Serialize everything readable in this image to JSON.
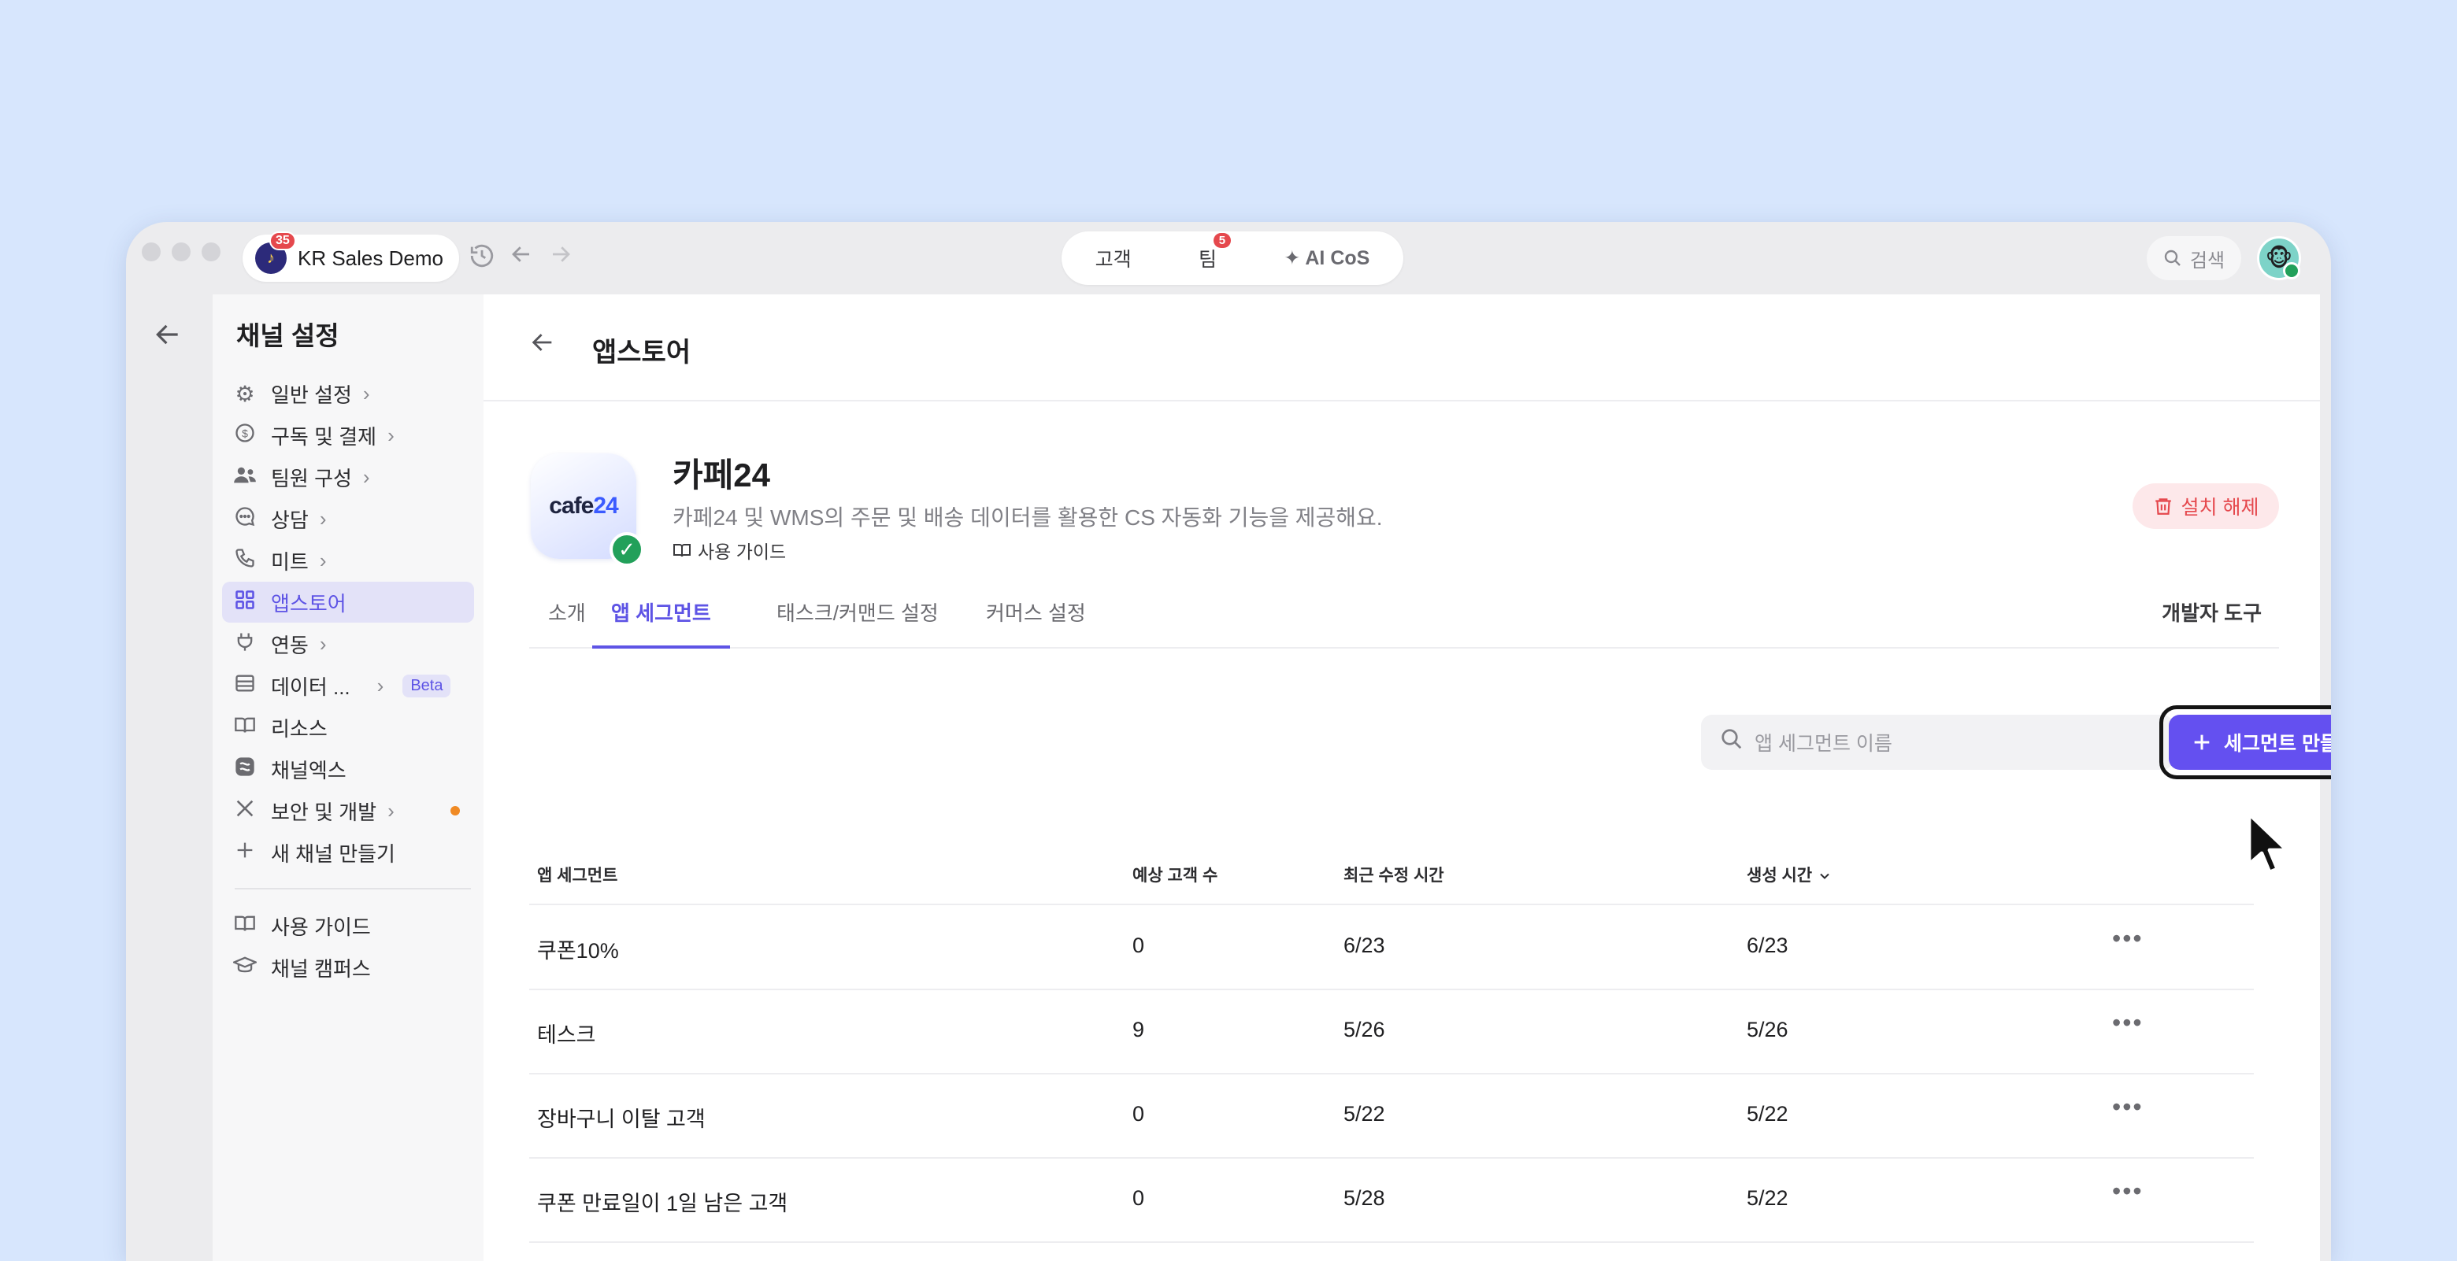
{
  "titlebar": {
    "workspace_name": "KR Sales Demo",
    "workspace_badge": "35",
    "center_tabs": [
      {
        "label": "고객"
      },
      {
        "label": "팀",
        "badge": "5"
      },
      {
        "label": "AI CoS"
      }
    ],
    "search_label": "검색"
  },
  "sidebar": {
    "title": "채널 설정",
    "items": [
      {
        "label": "일반 설정",
        "icon": "gear-icon"
      },
      {
        "label": "구독 및 결제",
        "icon": "dollar-icon"
      },
      {
        "label": "팀원 구성",
        "icon": "people-icon"
      },
      {
        "label": "상담",
        "icon": "chat-icon"
      },
      {
        "label": "미트",
        "icon": "phone-icon"
      },
      {
        "label": "앱스토어",
        "icon": "grid-icon"
      },
      {
        "label": "연동",
        "icon": "plug-icon"
      },
      {
        "label": "데이터 ...",
        "icon": "database-icon",
        "badge": "Beta"
      },
      {
        "label": "리소스",
        "icon": "book-icon"
      },
      {
        "label": "채널엑스",
        "icon": "channelx-icon"
      },
      {
        "label": "보안 및 개발",
        "icon": "tools-icon"
      },
      {
        "label": "새 채널 만들기",
        "icon": "plus-icon"
      },
      {
        "label": "사용 가이드",
        "icon": "book-icon"
      },
      {
        "label": "채널 캠퍼스",
        "icon": "graduation-icon"
      }
    ]
  },
  "main": {
    "page_title": "앱스토어",
    "app": {
      "logo_text_a": "cafe",
      "logo_text_b": "24",
      "name": "카페24",
      "description": "카페24 및 WMS의 주문 및 배송 데이터를 활용한 CS 자동화 기능을 제공해요.",
      "guide_label": "사용 가이드",
      "uninstall_label": "설치 해제"
    },
    "tabs": [
      "소개",
      "앱 세그먼트",
      "태스크/커맨드 설정",
      "커머스 설정"
    ],
    "active_tab": "앱 세그먼트",
    "dev_tools_label": "개발자 도구",
    "search_placeholder": "앱 세그먼트 이름",
    "create_button_label": "세그먼트 만들기",
    "table": {
      "columns": [
        "앱 세그먼트",
        "예상 고객 수",
        "최근 수정 시간",
        "생성 시간"
      ],
      "rows": [
        {
          "name": "쿠폰10%",
          "count": "0",
          "modified": "6/23",
          "created": "6/23"
        },
        {
          "name": "테스크",
          "count": "9",
          "modified": "5/26",
          "created": "5/26"
        },
        {
          "name": "장바구니 이탈 고객",
          "count": "0",
          "modified": "5/22",
          "created": "5/22"
        },
        {
          "name": "쿠폰 만료일이 1일 남은 고객",
          "count": "0",
          "modified": "5/28",
          "created": "5/22"
        }
      ]
    }
  },
  "colors": {
    "accent": "#6450f0",
    "background": "#d7e6fd",
    "danger": "#e5484d",
    "success": "#22a05a"
  }
}
